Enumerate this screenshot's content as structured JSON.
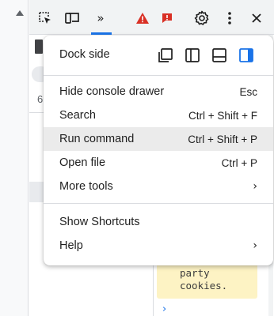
{
  "toolbar": {
    "icons": [
      "inspect-element-icon",
      "device-toggle-icon",
      "more-tabs-icon",
      "warning-icon",
      "issues-icon",
      "gear-icon",
      "kebab-menu-icon",
      "close-icon"
    ],
    "more_tabs_glyph": "»",
    "colors": {
      "warning": "#d93025",
      "accent": "#1a73e8"
    }
  },
  "background": {
    "ghost_text": "6",
    "code_lines": [
      "party",
      "cookies."
    ]
  },
  "menu": {
    "dock_side": {
      "label": "Dock side",
      "options": [
        "undock-icon",
        "dock-left-icon",
        "dock-bottom-icon",
        "dock-right-icon"
      ],
      "selected": "dock-right-icon"
    },
    "group1": [
      {
        "label": "Hide console drawer",
        "shortcut": "Esc"
      },
      {
        "label": "Search",
        "shortcut": "Ctrl + Shift + F"
      },
      {
        "label": "Run command",
        "shortcut": "Ctrl + Shift + P",
        "highlighted": true
      },
      {
        "label": "Open file",
        "shortcut": "Ctrl + P"
      },
      {
        "label": "More tools",
        "submenu": "›"
      }
    ],
    "group2": [
      {
        "label": "Show Shortcuts"
      },
      {
        "label": "Help",
        "submenu": "›"
      }
    ]
  }
}
